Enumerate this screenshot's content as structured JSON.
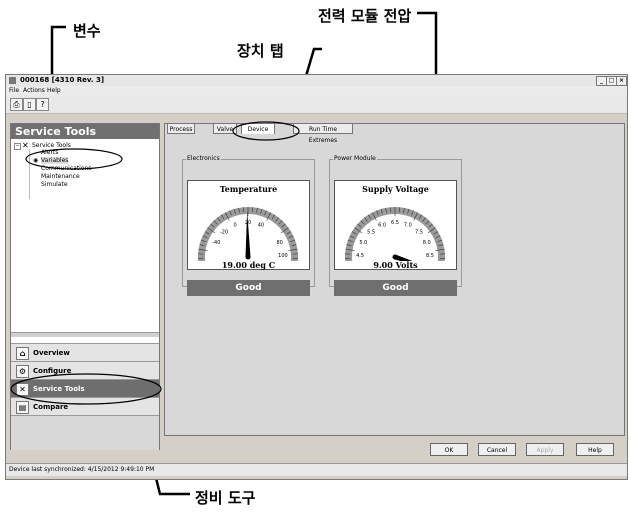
{
  "callouts": {
    "variables": "변수",
    "voltage": "전력 모듈 전압",
    "device_tab": "장치 탭",
    "service_tools": "정비 도구"
  },
  "window": {
    "title": "000168 [4310 Rev. 3]",
    "menu": [
      "File",
      "Actions",
      "Help"
    ],
    "controls": [
      "_",
      "□",
      "×"
    ]
  },
  "left_panel": {
    "header": "Service Tools",
    "tree": {
      "root": "Service Tools",
      "children": [
        "Alerts",
        "Variables",
        "Communications",
        "Maintenance",
        "Simulate"
      ]
    },
    "nav": [
      "Overview",
      "Configure",
      "Service Tools",
      "Compare"
    ]
  },
  "tabs": [
    "Process",
    "Valve",
    "Device",
    "Run Time Extremes"
  ],
  "groups": {
    "electronics": {
      "label": "Electronics",
      "gauge_title": "Temperature",
      "ticks": [
        "-80",
        "-40",
        "-20",
        "0",
        "20",
        "40",
        "80",
        "100",
        "120"
      ],
      "value": 19.0,
      "value_text": "19.00 deg C",
      "status": "Good"
    },
    "power_module": {
      "label": "Power Module",
      "gauge_title": "Supply Voltage",
      "ticks": [
        "4.0",
        "4.5",
        "5.0",
        "5.5",
        "6.0",
        "6.5",
        "7.0",
        "7.5",
        "8.0",
        "8.5",
        "9.0"
      ],
      "value": 9.0,
      "value_text": "9.00 Volts",
      "status": "Good"
    }
  },
  "buttons": [
    "OK",
    "Cancel",
    "Apply",
    "Help"
  ],
  "statusbar": "Device last synchronized: 4/15/2012 9:49:10 PM"
}
